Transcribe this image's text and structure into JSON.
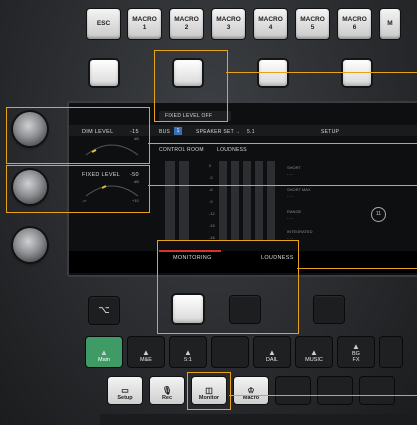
{
  "macro_keys": [
    "ESC",
    "MACRO\n1",
    "MACRO\n2",
    "MACRO\n3",
    "MACRO\n4",
    "MACRO\n5",
    "MACRO\n6",
    "M"
  ],
  "screen": {
    "fixed_level_tab": "FIXED LEVEL OFF",
    "bus_label": "BUS",
    "bus_value": "1",
    "speaker_set_label": "SPEAKER SET",
    "speaker_set_value": "5.1",
    "setup_label": "SETUP",
    "control_room_label": "CONTROL ROOM",
    "loudness_label": "LOUDNESS",
    "dim_level": {
      "label": "DIM LEVEL",
      "value": "-15",
      "unit": "dB"
    },
    "fixed_level": {
      "label": "FIXED LEVEL",
      "value": "-50",
      "unit": "dB",
      "min": "-∞",
      "max": "+10"
    },
    "meter_scale": [
      "0",
      "-3",
      "-6",
      "-9",
      "-12",
      "-15",
      "-18"
    ],
    "loudness_fields": [
      "SHORT",
      "SHORT MAX",
      "RANGE",
      "INTEGRATED"
    ],
    "loudness_placeholder": "- - -",
    "circle_button": "11",
    "tabs": [
      "MONITORING",
      "LOUDNESS"
    ]
  },
  "bottom_row1": [
    {
      "label": "Main",
      "icon": "speaker-icon",
      "active": true
    },
    {
      "label": "M&E",
      "icon": "speaker-icon"
    },
    {
      "label": "5:1",
      "icon": "speaker-icon"
    },
    {
      "label": "",
      "icon": ""
    },
    {
      "label": "DAIL",
      "icon": "speaker-icon"
    },
    {
      "label": "MUSIC",
      "icon": "speaker-icon"
    },
    {
      "label": "BG\nFX",
      "icon": "speaker-icon"
    }
  ],
  "bottom_row2": [
    {
      "label": "Setup",
      "icon": "setup-icon"
    },
    {
      "label": "Rec",
      "icon": "mic-icon"
    },
    {
      "label": "Monitor",
      "icon": "monitor-icon"
    },
    {
      "label": "Macro",
      "icon": "macro-icon"
    }
  ],
  "colors": {
    "callout": "#e8a21a",
    "active_key": "#3f9b66",
    "monitoring_underline": "#d9312b"
  }
}
